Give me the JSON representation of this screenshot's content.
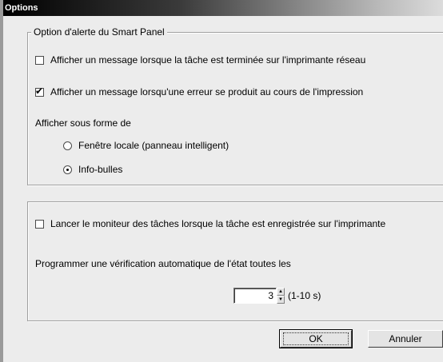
{
  "window": {
    "title": "Options"
  },
  "alert_group": {
    "legend": "Option d'alerte du Smart Panel",
    "checkbox_network": {
      "label": "Afficher un message lorsque la tâche est terminée sur l'imprimante réseau",
      "checked": false
    },
    "checkbox_error": {
      "label": "Afficher un message lorsqu'une erreur se produit au cours de l'impression",
      "checked": true
    },
    "display_as_label": "Afficher sous forme de",
    "radio_local": {
      "label": "Fenêtre locale (panneau intelligent)",
      "selected": false
    },
    "radio_tooltips": {
      "label": "Info-bulles",
      "selected": true
    }
  },
  "monitor_group": {
    "checkbox_monitor": {
      "label": "Lancer le moniteur des tâches lorsque la tâche est enregistrée sur l'imprimante",
      "checked": false
    },
    "schedule_label": "Programmer une vérification automatique de l'état toutes les",
    "interval_value": "3",
    "interval_range": "(1-10 s)"
  },
  "buttons": {
    "ok": "OK",
    "cancel": "Annuler"
  },
  "glyphs": {
    "check": "✔",
    "up": "▲",
    "down": "▼"
  }
}
